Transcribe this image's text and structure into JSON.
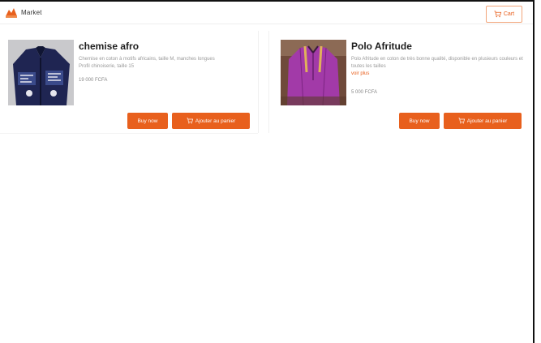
{
  "brand": {
    "name": "Market",
    "icon": "market-logo-icon"
  },
  "header": {
    "cart_label": "Cart",
    "cart_icon": "cart-icon"
  },
  "colors": {
    "accent": "#e8601d",
    "accent_border": "#f2a57a",
    "muted_text": "#999999"
  },
  "products": [
    {
      "title": "chemise afro",
      "description": "Chemise en coton à motifs africains, taille M, manches longues",
      "extra_line": "Profil chinoiserie, taille 15",
      "price": "19 000 FCFA",
      "more_label": "",
      "buy_label": "Buy now",
      "add_label": "Ajouter au panier",
      "image_desc": "navy afro jacket photo"
    },
    {
      "title": "Polo Afritude",
      "description": "Polo Afritude en coton de très bonne qualité, disponible en plusieurs couleurs et toutes les tailles",
      "extra_line": "",
      "more_label": "voir plus",
      "price": "5 000 FCFA",
      "buy_label": "Buy now",
      "add_label": "Ajouter au panier",
      "image_desc": "purple polo photo"
    }
  ]
}
